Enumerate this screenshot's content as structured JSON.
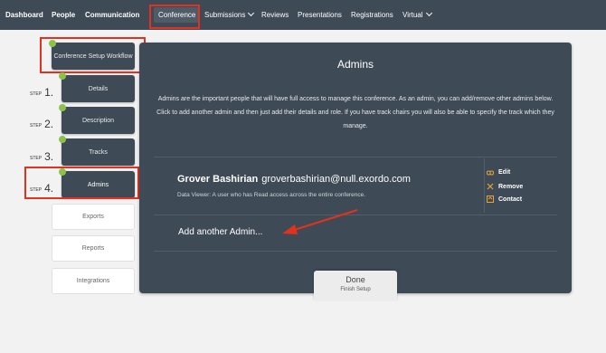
{
  "nav": {
    "items": [
      "Dashboard",
      "People",
      "Communication"
    ],
    "conference": "Conference",
    "submissions": "Submissions",
    "reviews": "Reviews",
    "presentations": "Presentations",
    "registrations": "Registrations",
    "virtual": "Virtual"
  },
  "sidebar": {
    "workflow_title": "Conference Setup Workflow",
    "step_word": "STEP",
    "steps": [
      {
        "num": "1.",
        "label": "Details"
      },
      {
        "num": "2.",
        "label": "Description"
      },
      {
        "num": "3.",
        "label": "Tracks"
      },
      {
        "num": "4.",
        "label": "Admins"
      }
    ],
    "links": [
      "Exports",
      "Reports",
      "Integrations"
    ]
  },
  "panel": {
    "title": "Admins",
    "description": "Admins are the important people that will have full access to manage this conference. As an admin, you can add/remove other admins below. Click to add another admin and then just add their details and role. If you have track chairs you will also be able to specify the track which they manage.",
    "admin": {
      "name": "Grover Bashirian",
      "email": "groverbashirian@null.exordo.com",
      "role": "Data Viewer: A user who has Read access across the entire conference."
    },
    "actions": {
      "edit": "Edit",
      "remove": "Remove",
      "contact": "Contact"
    },
    "add_admin": "Add another Admin...",
    "done": {
      "label": "Done",
      "sublabel": "Finish Setup"
    }
  },
  "colors": {
    "nav_bg": "#3e4a55",
    "panel_bg": "#3e4a55",
    "highlight": "#e0321f",
    "step_dot": "#8bc34a",
    "action_icon": "#e8a33c"
  }
}
